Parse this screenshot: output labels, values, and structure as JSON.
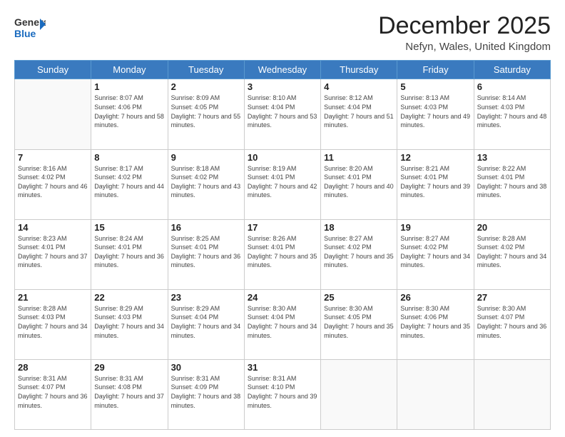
{
  "header": {
    "logo_line1": "General",
    "logo_line2": "Blue",
    "month_title": "December 2025",
    "location": "Nefyn, Wales, United Kingdom"
  },
  "days_of_week": [
    "Sunday",
    "Monday",
    "Tuesday",
    "Wednesday",
    "Thursday",
    "Friday",
    "Saturday"
  ],
  "weeks": [
    [
      {
        "day": "",
        "sunrise": "",
        "sunset": "",
        "daylight": ""
      },
      {
        "day": "1",
        "sunrise": "Sunrise: 8:07 AM",
        "sunset": "Sunset: 4:06 PM",
        "daylight": "Daylight: 7 hours and 58 minutes."
      },
      {
        "day": "2",
        "sunrise": "Sunrise: 8:09 AM",
        "sunset": "Sunset: 4:05 PM",
        "daylight": "Daylight: 7 hours and 55 minutes."
      },
      {
        "day": "3",
        "sunrise": "Sunrise: 8:10 AM",
        "sunset": "Sunset: 4:04 PM",
        "daylight": "Daylight: 7 hours and 53 minutes."
      },
      {
        "day": "4",
        "sunrise": "Sunrise: 8:12 AM",
        "sunset": "Sunset: 4:04 PM",
        "daylight": "Daylight: 7 hours and 51 minutes."
      },
      {
        "day": "5",
        "sunrise": "Sunrise: 8:13 AM",
        "sunset": "Sunset: 4:03 PM",
        "daylight": "Daylight: 7 hours and 49 minutes."
      },
      {
        "day": "6",
        "sunrise": "Sunrise: 8:14 AM",
        "sunset": "Sunset: 4:03 PM",
        "daylight": "Daylight: 7 hours and 48 minutes."
      }
    ],
    [
      {
        "day": "7",
        "sunrise": "Sunrise: 8:16 AM",
        "sunset": "Sunset: 4:02 PM",
        "daylight": "Daylight: 7 hours and 46 minutes."
      },
      {
        "day": "8",
        "sunrise": "Sunrise: 8:17 AM",
        "sunset": "Sunset: 4:02 PM",
        "daylight": "Daylight: 7 hours and 44 minutes."
      },
      {
        "day": "9",
        "sunrise": "Sunrise: 8:18 AM",
        "sunset": "Sunset: 4:02 PM",
        "daylight": "Daylight: 7 hours and 43 minutes."
      },
      {
        "day": "10",
        "sunrise": "Sunrise: 8:19 AM",
        "sunset": "Sunset: 4:01 PM",
        "daylight": "Daylight: 7 hours and 42 minutes."
      },
      {
        "day": "11",
        "sunrise": "Sunrise: 8:20 AM",
        "sunset": "Sunset: 4:01 PM",
        "daylight": "Daylight: 7 hours and 40 minutes."
      },
      {
        "day": "12",
        "sunrise": "Sunrise: 8:21 AM",
        "sunset": "Sunset: 4:01 PM",
        "daylight": "Daylight: 7 hours and 39 minutes."
      },
      {
        "day": "13",
        "sunrise": "Sunrise: 8:22 AM",
        "sunset": "Sunset: 4:01 PM",
        "daylight": "Daylight: 7 hours and 38 minutes."
      }
    ],
    [
      {
        "day": "14",
        "sunrise": "Sunrise: 8:23 AM",
        "sunset": "Sunset: 4:01 PM",
        "daylight": "Daylight: 7 hours and 37 minutes."
      },
      {
        "day": "15",
        "sunrise": "Sunrise: 8:24 AM",
        "sunset": "Sunset: 4:01 PM",
        "daylight": "Daylight: 7 hours and 36 minutes."
      },
      {
        "day": "16",
        "sunrise": "Sunrise: 8:25 AM",
        "sunset": "Sunset: 4:01 PM",
        "daylight": "Daylight: 7 hours and 36 minutes."
      },
      {
        "day": "17",
        "sunrise": "Sunrise: 8:26 AM",
        "sunset": "Sunset: 4:01 PM",
        "daylight": "Daylight: 7 hours and 35 minutes."
      },
      {
        "day": "18",
        "sunrise": "Sunrise: 8:27 AM",
        "sunset": "Sunset: 4:02 PM",
        "daylight": "Daylight: 7 hours and 35 minutes."
      },
      {
        "day": "19",
        "sunrise": "Sunrise: 8:27 AM",
        "sunset": "Sunset: 4:02 PM",
        "daylight": "Daylight: 7 hours and 34 minutes."
      },
      {
        "day": "20",
        "sunrise": "Sunrise: 8:28 AM",
        "sunset": "Sunset: 4:02 PM",
        "daylight": "Daylight: 7 hours and 34 minutes."
      }
    ],
    [
      {
        "day": "21",
        "sunrise": "Sunrise: 8:28 AM",
        "sunset": "Sunset: 4:03 PM",
        "daylight": "Daylight: 7 hours and 34 minutes."
      },
      {
        "day": "22",
        "sunrise": "Sunrise: 8:29 AM",
        "sunset": "Sunset: 4:03 PM",
        "daylight": "Daylight: 7 hours and 34 minutes."
      },
      {
        "day": "23",
        "sunrise": "Sunrise: 8:29 AM",
        "sunset": "Sunset: 4:04 PM",
        "daylight": "Daylight: 7 hours and 34 minutes."
      },
      {
        "day": "24",
        "sunrise": "Sunrise: 8:30 AM",
        "sunset": "Sunset: 4:04 PM",
        "daylight": "Daylight: 7 hours and 34 minutes."
      },
      {
        "day": "25",
        "sunrise": "Sunrise: 8:30 AM",
        "sunset": "Sunset: 4:05 PM",
        "daylight": "Daylight: 7 hours and 35 minutes."
      },
      {
        "day": "26",
        "sunrise": "Sunrise: 8:30 AM",
        "sunset": "Sunset: 4:06 PM",
        "daylight": "Daylight: 7 hours and 35 minutes."
      },
      {
        "day": "27",
        "sunrise": "Sunrise: 8:30 AM",
        "sunset": "Sunset: 4:07 PM",
        "daylight": "Daylight: 7 hours and 36 minutes."
      }
    ],
    [
      {
        "day": "28",
        "sunrise": "Sunrise: 8:31 AM",
        "sunset": "Sunset: 4:07 PM",
        "daylight": "Daylight: 7 hours and 36 minutes."
      },
      {
        "day": "29",
        "sunrise": "Sunrise: 8:31 AM",
        "sunset": "Sunset: 4:08 PM",
        "daylight": "Daylight: 7 hours and 37 minutes."
      },
      {
        "day": "30",
        "sunrise": "Sunrise: 8:31 AM",
        "sunset": "Sunset: 4:09 PM",
        "daylight": "Daylight: 7 hours and 38 minutes."
      },
      {
        "day": "31",
        "sunrise": "Sunrise: 8:31 AM",
        "sunset": "Sunset: 4:10 PM",
        "daylight": "Daylight: 7 hours and 39 minutes."
      },
      {
        "day": "",
        "sunrise": "",
        "sunset": "",
        "daylight": ""
      },
      {
        "day": "",
        "sunrise": "",
        "sunset": "",
        "daylight": ""
      },
      {
        "day": "",
        "sunrise": "",
        "sunset": "",
        "daylight": ""
      }
    ]
  ]
}
